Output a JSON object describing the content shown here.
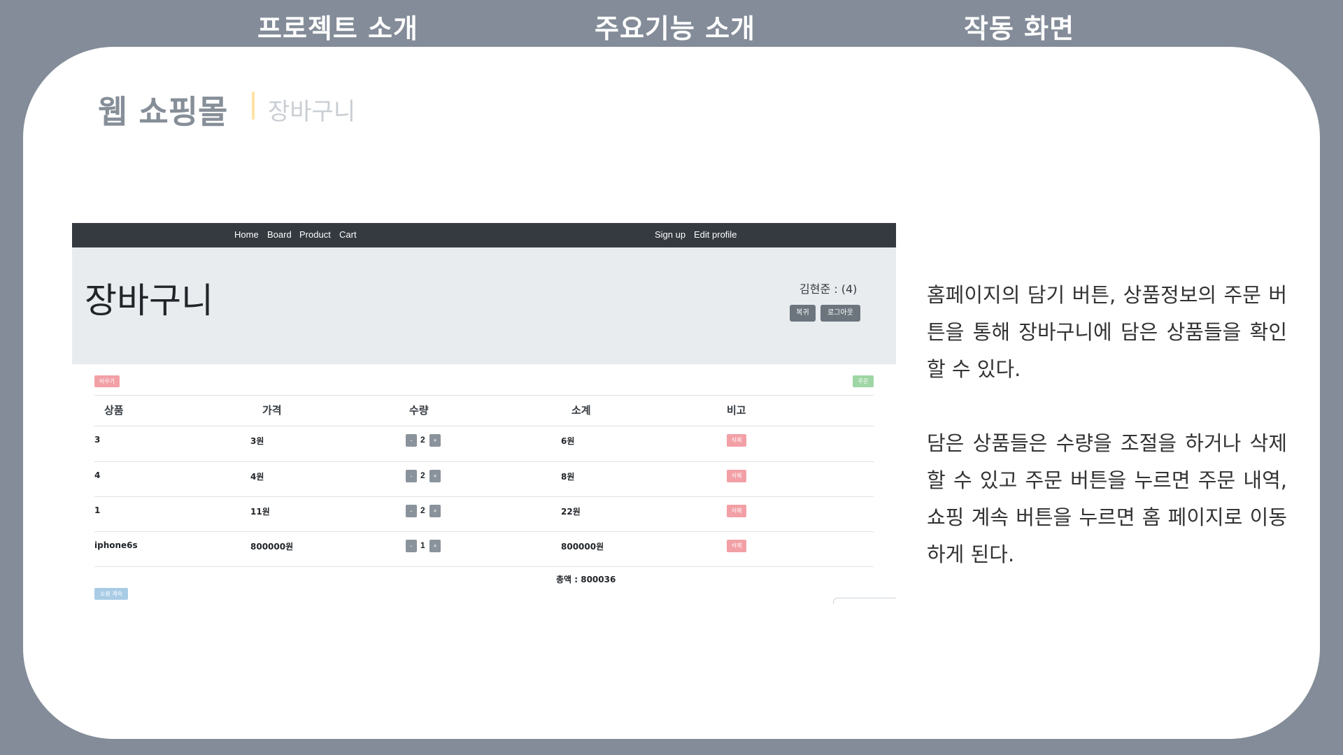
{
  "top_tabs": [
    "프로젝트 소개",
    "주요기능 소개",
    "작동 화면"
  ],
  "slide": {
    "title": "웹 쇼핑몰",
    "subtitle": "장바구니"
  },
  "screenshot": {
    "nav_left": [
      "Home",
      "Board",
      "Product",
      "Cart"
    ],
    "nav_right": [
      "Sign up",
      "Edit profile"
    ],
    "page_title": "장바구니",
    "user_info": "김현준 : (4)",
    "buttons": {
      "back": "복귀",
      "logout": "로그아웃",
      "clear": "비우기",
      "order": "주문",
      "continue": "쇼핑 계속"
    },
    "table": {
      "headers": [
        "상품",
        "가격",
        "수량",
        "소계",
        "비고"
      ],
      "rows": [
        {
          "product": "3",
          "price": "3원",
          "qty": "2",
          "subtotal": "6원",
          "action": "삭제"
        },
        {
          "product": "4",
          "price": "4원",
          "qty": "2",
          "subtotal": "8원",
          "action": "삭제"
        },
        {
          "product": "1",
          "price": "11원",
          "qty": "2",
          "subtotal": "22원",
          "action": "삭제"
        },
        {
          "product": "iphone6s",
          "price": "800000원",
          "qty": "1",
          "subtotal": "800000원",
          "action": "삭제"
        }
      ],
      "qty_minus": "-",
      "qty_plus": "+"
    },
    "total": "총액 : 800036"
  },
  "description": {
    "paragraph1": "홈페이지의 담기 버튼, 상품정보의 주문 버튼을 통해 장바구니에 담은 상품들을 확인할 수 있다.",
    "paragraph2": "담은 상품들은 수량을 조절을 하거나 삭제할 수 있고 주문 버튼을 누르면 주문 내역, 쇼핑 계속 버튼을 누르면 홈 페이지로 이동하게 된다."
  },
  "colors": {
    "background": "#838c98",
    "card": "#ffffff",
    "navbar": "#343a40",
    "jumbotron": "#e9ecef",
    "accent_divider": "#fde3a6",
    "danger_light": "#f2a0a6",
    "success_light": "#9fd6a5",
    "info_light": "#a9cce6"
  }
}
